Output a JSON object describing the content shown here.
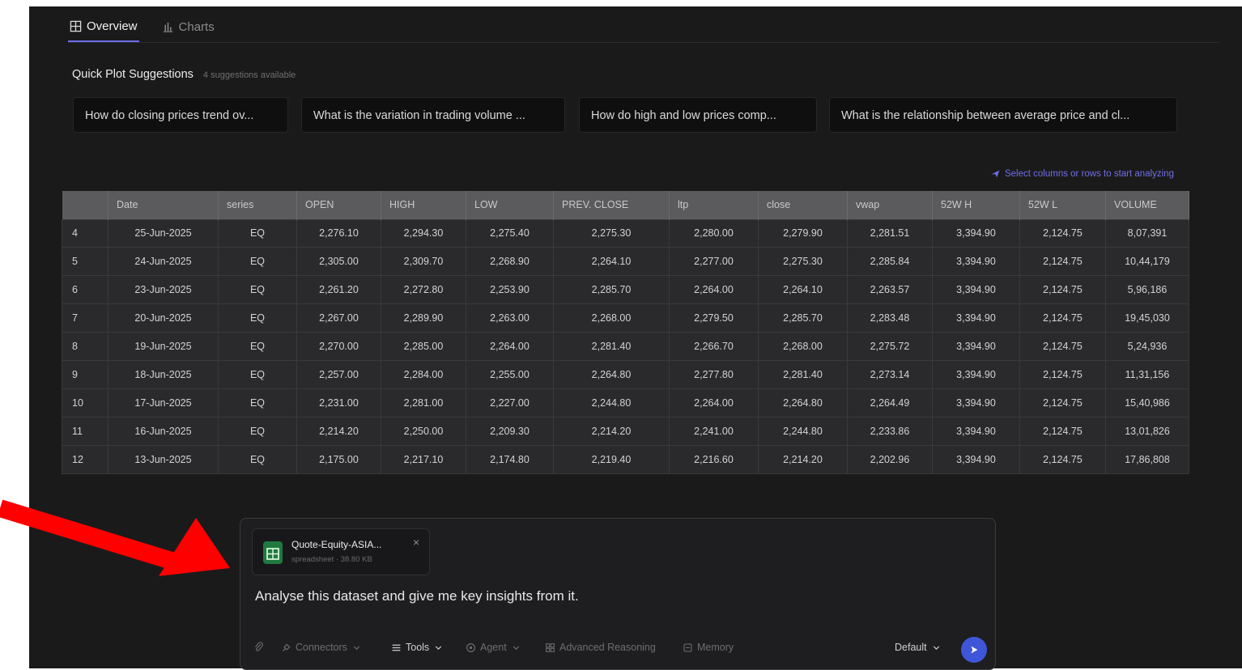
{
  "tabs": [
    {
      "label": "Overview",
      "active": true,
      "icon": "grid-icon"
    },
    {
      "label": "Charts",
      "active": false,
      "icon": "bar-chart-icon"
    }
  ],
  "suggestions": {
    "title": "Quick Plot Suggestions",
    "count_text": "4 suggestions available",
    "items": [
      "How do closing prices trend ov...",
      "What is the variation in trading volume ...",
      "How do high and low prices comp...",
      "What is the relationship between average price and cl..."
    ]
  },
  "hint": "Select columns or rows to start analyzing",
  "table": {
    "columns": [
      "",
      "Date",
      "series",
      "OPEN",
      "HIGH",
      "LOW",
      "PREV. CLOSE",
      "ltp",
      "close",
      "vwap",
      "52W H",
      "52W L",
      "VOLUME"
    ],
    "rows": [
      [
        "4",
        "25-Jun-2025",
        "EQ",
        "2,276.10",
        "2,294.30",
        "2,275.40",
        "2,275.30",
        "2,280.00",
        "2,279.90",
        "2,281.51",
        "3,394.90",
        "2,124.75",
        "8,07,391"
      ],
      [
        "5",
        "24-Jun-2025",
        "EQ",
        "2,305.00",
        "2,309.70",
        "2,268.90",
        "2,264.10",
        "2,277.00",
        "2,275.30",
        "2,285.84",
        "3,394.90",
        "2,124.75",
        "10,44,179"
      ],
      [
        "6",
        "23-Jun-2025",
        "EQ",
        "2,261.20",
        "2,272.80",
        "2,253.90",
        "2,285.70",
        "2,264.00",
        "2,264.10",
        "2,263.57",
        "3,394.90",
        "2,124.75",
        "5,96,186"
      ],
      [
        "7",
        "20-Jun-2025",
        "EQ",
        "2,267.00",
        "2,289.90",
        "2,263.00",
        "2,268.00",
        "2,279.50",
        "2,285.70",
        "2,283.48",
        "3,394.90",
        "2,124.75",
        "19,45,030"
      ],
      [
        "8",
        "19-Jun-2025",
        "EQ",
        "2,270.00",
        "2,285.00",
        "2,264.00",
        "2,281.40",
        "2,266.70",
        "2,268.00",
        "2,275.72",
        "3,394.90",
        "2,124.75",
        "5,24,936"
      ],
      [
        "9",
        "18-Jun-2025",
        "EQ",
        "2,257.00",
        "2,284.00",
        "2,255.00",
        "2,264.80",
        "2,277.80",
        "2,281.40",
        "2,273.14",
        "3,394.90",
        "2,124.75",
        "11,31,156"
      ],
      [
        "10",
        "17-Jun-2025",
        "EQ",
        "2,231.00",
        "2,281.00",
        "2,227.00",
        "2,244.80",
        "2,264.00",
        "2,264.80",
        "2,264.49",
        "3,394.90",
        "2,124.75",
        "15,40,986"
      ],
      [
        "11",
        "16-Jun-2025",
        "EQ",
        "2,214.20",
        "2,250.00",
        "2,209.30",
        "2,214.20",
        "2,241.00",
        "2,244.80",
        "2,233.86",
        "3,394.90",
        "2,124.75",
        "13,01,826"
      ],
      [
        "12",
        "13-Jun-2025",
        "EQ",
        "2,175.00",
        "2,217.10",
        "2,174.80",
        "2,219.40",
        "2,216.60",
        "2,214.20",
        "2,202.96",
        "3,394.90",
        "2,124.75",
        "17,86,808"
      ]
    ]
  },
  "composer": {
    "file": {
      "name": "Quote-Equity-ASIA...",
      "meta": "spreadsheet · 38.80 KB",
      "icon": "spreadsheet-icon"
    },
    "prompt": "Analyse this dataset and give me key insights from it.",
    "tools": {
      "connectors": "Connectors",
      "tools": "Tools",
      "agent": "Agent",
      "advanced": "Advanced Reasoning",
      "memory": "Memory",
      "model": "Default"
    }
  },
  "colors": {
    "accent": "#6d6de8",
    "send": "#3f56d8",
    "arrow": "#ff0000"
  }
}
